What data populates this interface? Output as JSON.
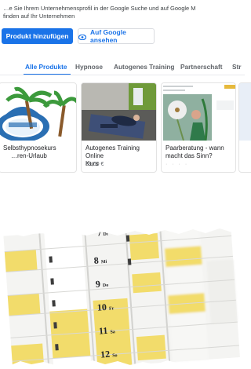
{
  "intro": {
    "line1": "…e Sie Ihrem Unternehmensprofil in der Google Suche und auf Google M",
    "line2": "finden auf Ihr Unternehmen"
  },
  "actions": {
    "add_product": "Produkt hinzufügen",
    "view_on_google": "Auf Google ansehen"
  },
  "tabs": [
    "Alle Produkte",
    "Hypnose",
    "Autogenes Training",
    "Partnerschaft",
    "Str"
  ],
  "products": [
    {
      "title_line1": "Selbsthypnosekurs",
      "title_line2": "…ren-Urlaub",
      "price": ""
    },
    {
      "title_line1": "Autogenes Training Online",
      "title_line2": "Kurs",
      "price": "89,00 €"
    },
    {
      "title_line1": "Paarberatung - wann",
      "title_line2": "macht das Sinn?",
      "price": ""
    }
  ],
  "colors": {
    "brand_blue": "#1a73e8",
    "calendar_yellow": "#f2dc6b"
  },
  "calendar": {
    "days": [
      "7",
      "8",
      "9",
      "10",
      "11",
      "12"
    ],
    "weekday_abbr": [
      "Di",
      "Mi",
      "Do",
      "Fr",
      "Sa",
      "So"
    ]
  }
}
